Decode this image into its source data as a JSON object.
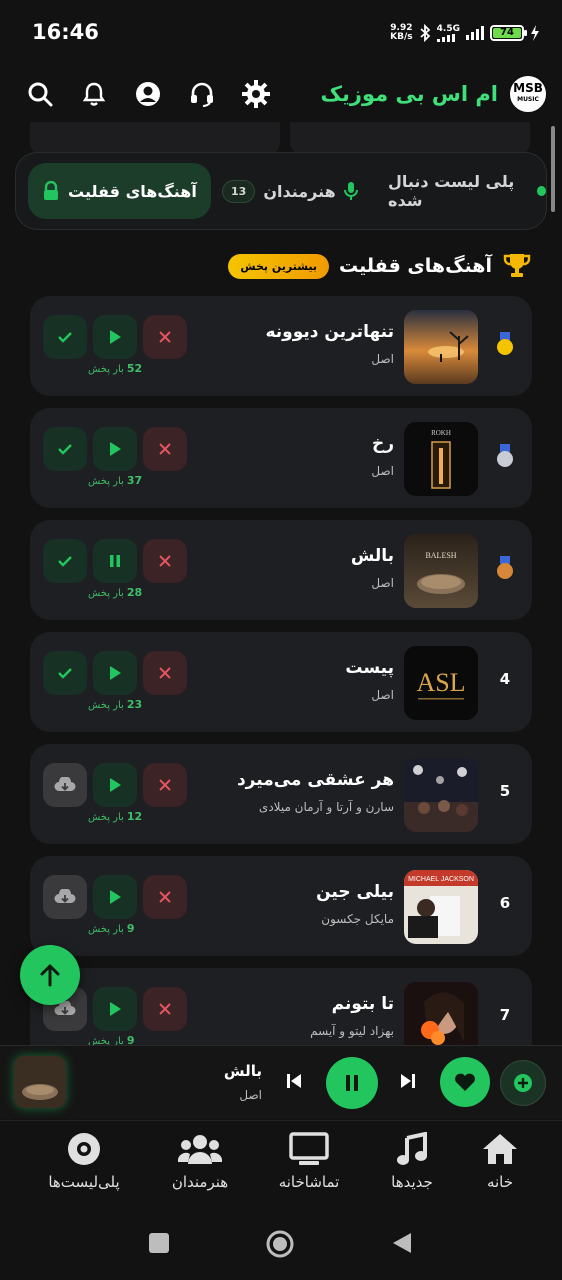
{
  "status": {
    "time": "16:46",
    "net_speed_value": "9.92",
    "net_speed_unit": "KB/s",
    "network": "4.5G",
    "battery": "74"
  },
  "header": {
    "title": "ام اس بی موزیک",
    "logo_text": "MSB",
    "logo_sub": "MUSIC"
  },
  "tabs": [
    {
      "label": "آهنگ‌های قفلیت",
      "icon": "lock-icon",
      "active": true
    },
    {
      "label": "هنرمندان",
      "badge": "13",
      "icon": "mic-icon"
    },
    {
      "label": "پلی لیست دنبال شده",
      "icon": "playlist-icon"
    }
  ],
  "section": {
    "title": "آهنگ‌های قفلیت",
    "pill": "بیشترین پخش"
  },
  "plays_suffix": "بار پخش",
  "songs": [
    {
      "rank": "1",
      "medal": "gold",
      "title": "تنهاترین دیوونه",
      "artist": "اصل",
      "plays": "52",
      "first_action": "check",
      "state": "play"
    },
    {
      "rank": "2",
      "medal": "silver",
      "title": "رخ",
      "artist": "اصل",
      "plays": "37",
      "first_action": "check",
      "state": "play"
    },
    {
      "rank": "3",
      "medal": "bronze",
      "title": "بالش",
      "artist": "اصل",
      "plays": "28",
      "first_action": "check",
      "state": "pause"
    },
    {
      "rank": "4",
      "title": "پیست",
      "artist": "اصل",
      "plays": "23",
      "first_action": "check",
      "state": "play"
    },
    {
      "rank": "5",
      "title": "هر عشقی می‌میرد",
      "artist": "سارن و آرتا و آرمان میلادی",
      "plays": "12",
      "first_action": "download",
      "state": "play"
    },
    {
      "rank": "6",
      "title": "بیلی جین",
      "artist": "مایکل جکسون",
      "plays": "9",
      "first_action": "download",
      "state": "play"
    },
    {
      "rank": "7",
      "title": "تا بتونم",
      "artist": "بهزاد لیتو و آیسم",
      "plays": "9",
      "first_action": "download",
      "state": "play"
    }
  ],
  "cover_texts": {
    "rokh": "ROKH",
    "balesh": "BALESH",
    "asl": "ASL",
    "mj": "MICHAEL JACKSON"
  },
  "player": {
    "title": "بالش",
    "artist": "اصل"
  },
  "nav": [
    {
      "label": "خانه",
      "icon": "home-icon"
    },
    {
      "label": "جدیدها",
      "icon": "music-note-icon"
    },
    {
      "label": "تماشاخانه",
      "icon": "tv-icon"
    },
    {
      "label": "هنرمندان",
      "icon": "users-icon"
    },
    {
      "label": "پلی‌لیست‌ها",
      "icon": "disc-icon"
    }
  ],
  "colors": {
    "accent": "#22c55e",
    "background": "#121212",
    "card": "#1e1f22",
    "brand_text": "#3fe07a"
  }
}
